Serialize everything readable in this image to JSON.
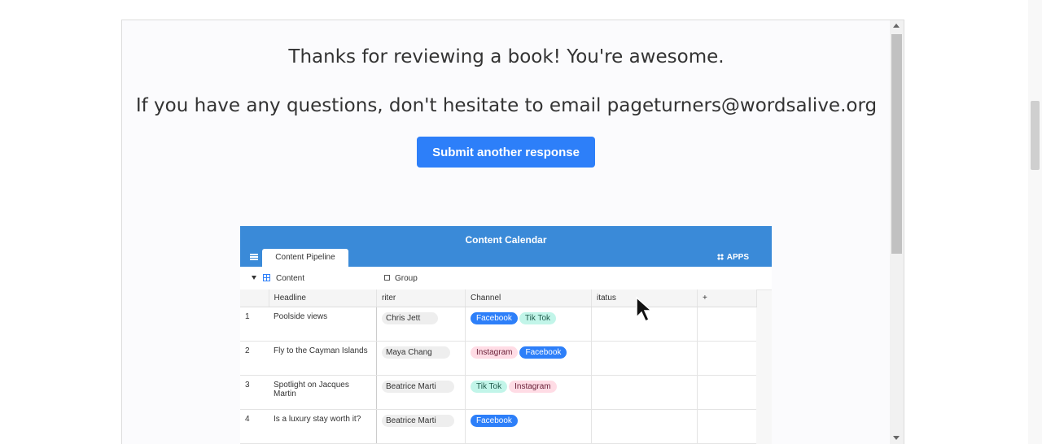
{
  "messages": {
    "thanks": "Thanks for reviewing a book! You're awesome.",
    "questions": "If you have any questions, don't hesitate to email pageturners@wordsalive.org"
  },
  "submit_button": "Submit another response",
  "calendar": {
    "title": "Content Calendar",
    "tab": "Content Pipeline",
    "apps": "APPS",
    "view": "Content",
    "group": "Group",
    "columns": {
      "headline": "Headline",
      "writer": "riter",
      "channel": "Channel",
      "status": "itatus",
      "add": "+"
    },
    "rows": [
      {
        "num": "1",
        "headline": "Poolside views",
        "writer": "Chris Jett",
        "channels": [
          "Facebook",
          "Tik Tok"
        ]
      },
      {
        "num": "2",
        "headline": "Fly to the Cayman Islands",
        "writer": "Maya Chang",
        "channels": [
          "Instagram",
          "Facebook"
        ]
      },
      {
        "num": "3",
        "headline": "Spotlight on Jacques Martin",
        "writer": "Beatrice Marti",
        "channels": [
          "Tik Tok",
          "Instagram"
        ]
      },
      {
        "num": "4",
        "headline": "Is a luxury stay worth it?",
        "writer": "Beatrice Marti",
        "channels": [
          "Facebook"
        ]
      }
    ]
  },
  "colors": {
    "accent": "#2d7ff9",
    "header": "#3a8ad8",
    "facebook": "#2d7ff9",
    "tiktok": "#c2f5e9",
    "instagram": "#ffdce5"
  }
}
